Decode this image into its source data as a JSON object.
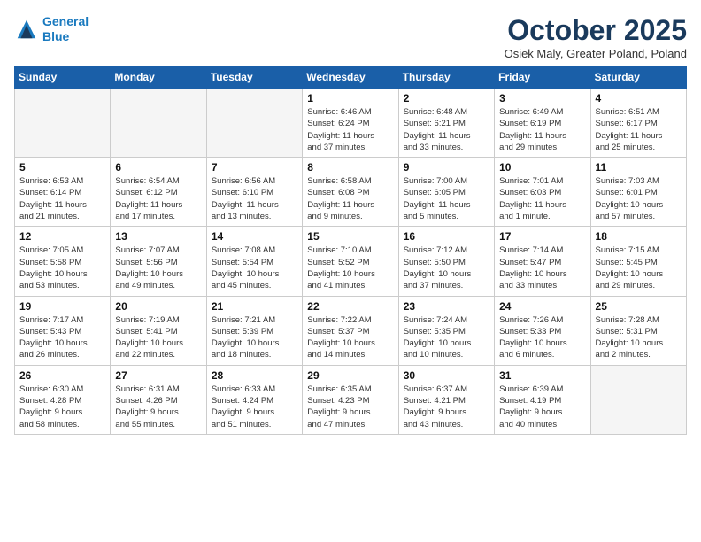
{
  "header": {
    "logo_line1": "General",
    "logo_line2": "Blue",
    "month_title": "October 2025",
    "subtitle": "Osiek Maly, Greater Poland, Poland"
  },
  "weekdays": [
    "Sunday",
    "Monday",
    "Tuesday",
    "Wednesday",
    "Thursday",
    "Friday",
    "Saturday"
  ],
  "weeks": [
    [
      {
        "day": "",
        "info": ""
      },
      {
        "day": "",
        "info": ""
      },
      {
        "day": "",
        "info": ""
      },
      {
        "day": "1",
        "info": "Sunrise: 6:46 AM\nSunset: 6:24 PM\nDaylight: 11 hours\nand 37 minutes."
      },
      {
        "day": "2",
        "info": "Sunrise: 6:48 AM\nSunset: 6:21 PM\nDaylight: 11 hours\nand 33 minutes."
      },
      {
        "day": "3",
        "info": "Sunrise: 6:49 AM\nSunset: 6:19 PM\nDaylight: 11 hours\nand 29 minutes."
      },
      {
        "day": "4",
        "info": "Sunrise: 6:51 AM\nSunset: 6:17 PM\nDaylight: 11 hours\nand 25 minutes."
      }
    ],
    [
      {
        "day": "5",
        "info": "Sunrise: 6:53 AM\nSunset: 6:14 PM\nDaylight: 11 hours\nand 21 minutes."
      },
      {
        "day": "6",
        "info": "Sunrise: 6:54 AM\nSunset: 6:12 PM\nDaylight: 11 hours\nand 17 minutes."
      },
      {
        "day": "7",
        "info": "Sunrise: 6:56 AM\nSunset: 6:10 PM\nDaylight: 11 hours\nand 13 minutes."
      },
      {
        "day": "8",
        "info": "Sunrise: 6:58 AM\nSunset: 6:08 PM\nDaylight: 11 hours\nand 9 minutes."
      },
      {
        "day": "9",
        "info": "Sunrise: 7:00 AM\nSunset: 6:05 PM\nDaylight: 11 hours\nand 5 minutes."
      },
      {
        "day": "10",
        "info": "Sunrise: 7:01 AM\nSunset: 6:03 PM\nDaylight: 11 hours\nand 1 minute."
      },
      {
        "day": "11",
        "info": "Sunrise: 7:03 AM\nSunset: 6:01 PM\nDaylight: 10 hours\nand 57 minutes."
      }
    ],
    [
      {
        "day": "12",
        "info": "Sunrise: 7:05 AM\nSunset: 5:58 PM\nDaylight: 10 hours\nand 53 minutes."
      },
      {
        "day": "13",
        "info": "Sunrise: 7:07 AM\nSunset: 5:56 PM\nDaylight: 10 hours\nand 49 minutes."
      },
      {
        "day": "14",
        "info": "Sunrise: 7:08 AM\nSunset: 5:54 PM\nDaylight: 10 hours\nand 45 minutes."
      },
      {
        "day": "15",
        "info": "Sunrise: 7:10 AM\nSunset: 5:52 PM\nDaylight: 10 hours\nand 41 minutes."
      },
      {
        "day": "16",
        "info": "Sunrise: 7:12 AM\nSunset: 5:50 PM\nDaylight: 10 hours\nand 37 minutes."
      },
      {
        "day": "17",
        "info": "Sunrise: 7:14 AM\nSunset: 5:47 PM\nDaylight: 10 hours\nand 33 minutes."
      },
      {
        "day": "18",
        "info": "Sunrise: 7:15 AM\nSunset: 5:45 PM\nDaylight: 10 hours\nand 29 minutes."
      }
    ],
    [
      {
        "day": "19",
        "info": "Sunrise: 7:17 AM\nSunset: 5:43 PM\nDaylight: 10 hours\nand 26 minutes."
      },
      {
        "day": "20",
        "info": "Sunrise: 7:19 AM\nSunset: 5:41 PM\nDaylight: 10 hours\nand 22 minutes."
      },
      {
        "day": "21",
        "info": "Sunrise: 7:21 AM\nSunset: 5:39 PM\nDaylight: 10 hours\nand 18 minutes."
      },
      {
        "day": "22",
        "info": "Sunrise: 7:22 AM\nSunset: 5:37 PM\nDaylight: 10 hours\nand 14 minutes."
      },
      {
        "day": "23",
        "info": "Sunrise: 7:24 AM\nSunset: 5:35 PM\nDaylight: 10 hours\nand 10 minutes."
      },
      {
        "day": "24",
        "info": "Sunrise: 7:26 AM\nSunset: 5:33 PM\nDaylight: 10 hours\nand 6 minutes."
      },
      {
        "day": "25",
        "info": "Sunrise: 7:28 AM\nSunset: 5:31 PM\nDaylight: 10 hours\nand 2 minutes."
      }
    ],
    [
      {
        "day": "26",
        "info": "Sunrise: 6:30 AM\nSunset: 4:28 PM\nDaylight: 9 hours\nand 58 minutes."
      },
      {
        "day": "27",
        "info": "Sunrise: 6:31 AM\nSunset: 4:26 PM\nDaylight: 9 hours\nand 55 minutes."
      },
      {
        "day": "28",
        "info": "Sunrise: 6:33 AM\nSunset: 4:24 PM\nDaylight: 9 hours\nand 51 minutes."
      },
      {
        "day": "29",
        "info": "Sunrise: 6:35 AM\nSunset: 4:23 PM\nDaylight: 9 hours\nand 47 minutes."
      },
      {
        "day": "30",
        "info": "Sunrise: 6:37 AM\nSunset: 4:21 PM\nDaylight: 9 hours\nand 43 minutes."
      },
      {
        "day": "31",
        "info": "Sunrise: 6:39 AM\nSunset: 4:19 PM\nDaylight: 9 hours\nand 40 minutes."
      },
      {
        "day": "",
        "info": ""
      }
    ]
  ]
}
